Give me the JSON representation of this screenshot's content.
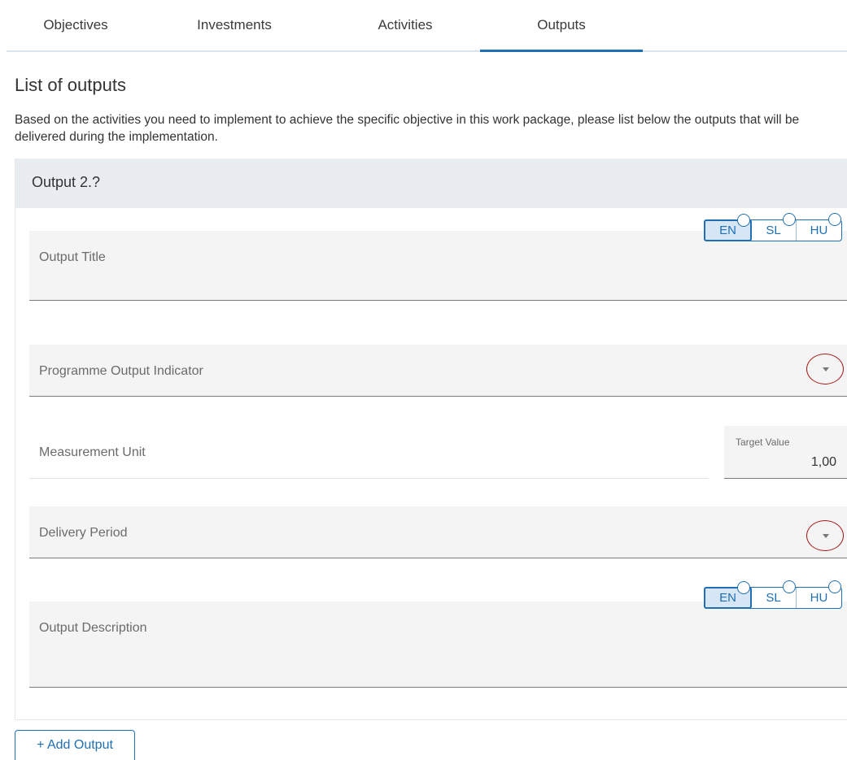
{
  "tabs": [
    {
      "label": "Objectives"
    },
    {
      "label": "Investments"
    },
    {
      "label": "Activities"
    },
    {
      "label": "Outputs",
      "active": true
    }
  ],
  "section": {
    "title": "List of outputs",
    "description": "Based on the activities you need to implement to achieve the specific objective in this work package, please list below the outputs that will be delivered during the implementation."
  },
  "output": {
    "header": "Output 2.?",
    "languages": [
      "EN",
      "SL",
      "HU"
    ],
    "selected_language": "EN",
    "title_field": {
      "label": "Output Title",
      "value": ""
    },
    "indicator_field": {
      "label": "Programme Output Indicator",
      "value": ""
    },
    "measurement_unit": {
      "label": "Measurement Unit",
      "value": ""
    },
    "target_value": {
      "label": "Target Value",
      "value": "1,00"
    },
    "delivery_period": {
      "label": "Delivery Period",
      "value": ""
    },
    "description_field": {
      "label": "Output Description",
      "value": ""
    }
  },
  "actions": {
    "add_output": "+ Add Output"
  },
  "colors": {
    "accent": "#1f6fb2",
    "highlight_circle": "#a61c1c",
    "header_bg": "#e9edf1",
    "field_bg": "#f4f4f4"
  },
  "icons": {
    "dropdown": "caret-down-icon",
    "language_marker": "circle-icon"
  }
}
